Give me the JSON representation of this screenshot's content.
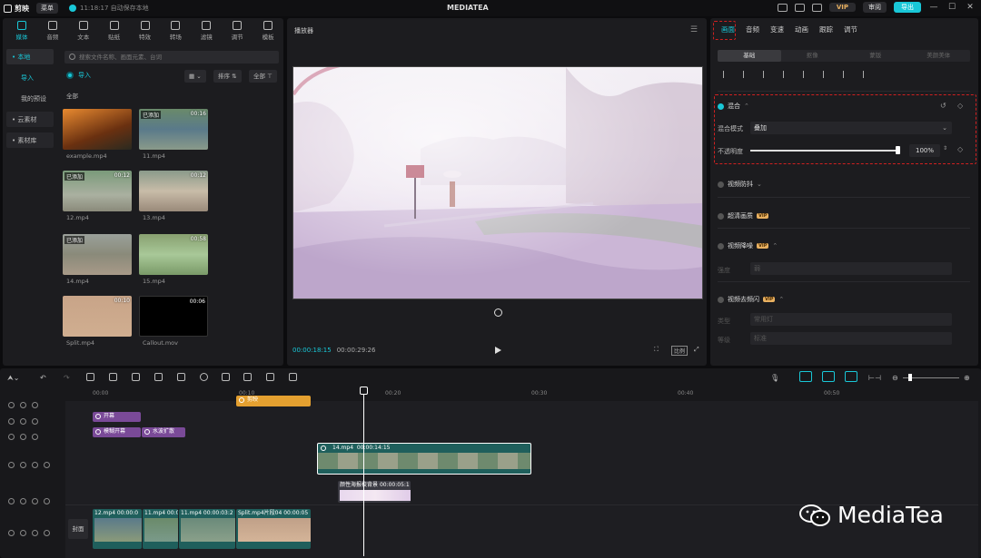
{
  "titlebar": {
    "logo": "剪映",
    "menu": "菜单",
    "autosave": "11:18:17 自动保存本地",
    "title": "MEDIATEA",
    "vip": "VIP",
    "review": "审阅",
    "export": "导出"
  },
  "tools": [
    {
      "label": "媒体",
      "icon": "media-icon",
      "active": true
    },
    {
      "label": "音频",
      "icon": "audio-icon"
    },
    {
      "label": "文本",
      "icon": "text-icon"
    },
    {
      "label": "贴纸",
      "icon": "sticker-icon"
    },
    {
      "label": "特效",
      "icon": "effects-icon"
    },
    {
      "label": "转场",
      "icon": "transition-icon"
    },
    {
      "label": "滤镜",
      "icon": "filter-icon"
    },
    {
      "label": "调节",
      "icon": "adjust-icon"
    },
    {
      "label": "模板",
      "icon": "template-icon"
    }
  ],
  "sidenav": {
    "local": "• 本地",
    "import": "导入",
    "presets": "我的预设",
    "cloud": "• 云素材",
    "library": "• 素材库"
  },
  "media": {
    "search_placeholder": "搜索文件名称、画面元素、台词",
    "import_label": "导入",
    "view_label": "▦ ⌄",
    "sort_label": "排序 ⇅",
    "filter_label": "全部 ⊤",
    "all_label": "全部",
    "items": [
      {
        "name": "example.mp4",
        "badge": "",
        "duration": ""
      },
      {
        "name": "11.mp4",
        "badge": "已添加",
        "duration": "00:16"
      },
      {
        "name": "12.mp4",
        "badge": "已添加",
        "duration": "00:12"
      },
      {
        "name": "13.mp4",
        "badge": "",
        "duration": "00:12"
      },
      {
        "name": "14.mp4",
        "badge": "已添加",
        "duration": ""
      },
      {
        "name": "15.mp4",
        "badge": "",
        "duration": "00:58"
      },
      {
        "name": "Split.mp4",
        "badge": "",
        "duration": "00:10"
      },
      {
        "name": "Callout.mov",
        "badge": "",
        "duration": "00:06"
      }
    ]
  },
  "player": {
    "title": "播放器",
    "current": "00:00:18:15",
    "total": "00:00:29:26",
    "ratio": "比例"
  },
  "inspector": {
    "tabs": [
      {
        "label": "画面",
        "active": true
      },
      {
        "label": "音频"
      },
      {
        "label": "变速"
      },
      {
        "label": "动画"
      },
      {
        "label": "跟踪"
      },
      {
        "label": "调节"
      }
    ],
    "subtabs": [
      {
        "label": "基础",
        "active": true
      },
      {
        "label": "抠像"
      },
      {
        "label": "蒙版"
      },
      {
        "label": "美颜美体"
      }
    ],
    "blend_title": "混合",
    "blend_mode_label": "混合模式",
    "blend_mode_value": "叠加",
    "opacity_label": "不透明度",
    "opacity_value": "100%",
    "opacity": 1.0,
    "stabilize": "视频防抖",
    "hd": "超清画质",
    "denoise": "视频降噪",
    "denoise_strength_label": "强度",
    "denoise_strength_value": "弱",
    "deflicker": "视频去频闪",
    "deflicker_type_label": "类型",
    "deflicker_type_value": "常用灯",
    "deflicker_level_label": "等级",
    "deflicker_level_value": "标准",
    "vip_badge": "VIP"
  },
  "timeline": {
    "ruler": [
      "00:00",
      "00:10",
      "00:20",
      "00:30",
      "00:40",
      "00:50"
    ],
    "clips": {
      "audio": "剪映",
      "text1": "开幕",
      "fx1": "模糊开幕",
      "fx2": "水波扩散",
      "main_name": "14.mp4",
      "main_dur": "00:00:14:15",
      "overlay": "颜性海报校背景",
      "overlay_dur": "00:00:05:1",
      "base": [
        "12.mp4  00:00:0",
        "11.mp4  00:0",
        "11.mp4  00:00:03:2",
        "Split.mp4片段04  00:00:05"
      ]
    },
    "cover": "封面"
  },
  "watermark": "MediaTea",
  "colors": {
    "accent": "#19c7d7",
    "vip": "#e8b060",
    "highlight": "#d02020"
  }
}
